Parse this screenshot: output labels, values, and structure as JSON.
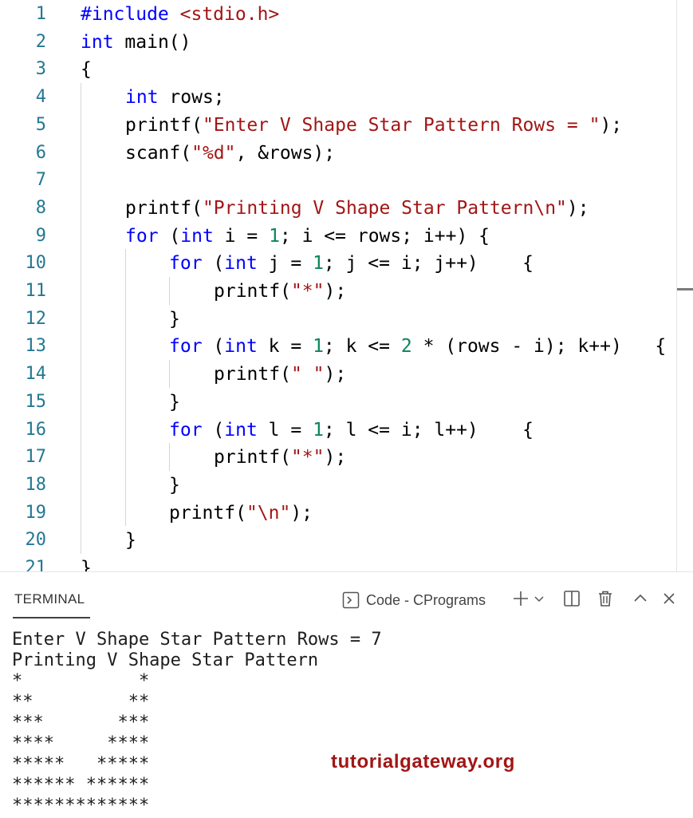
{
  "editor": {
    "line_numbers": [
      "1",
      "2",
      "3",
      "4",
      "5",
      "6",
      "7",
      "8",
      "9",
      "10",
      "11",
      "12",
      "13",
      "14",
      "15",
      "16",
      "17",
      "18",
      "19",
      "20",
      "21"
    ],
    "code": {
      "l1_kw": "#include",
      "l1_str": "<stdio.h>",
      "l2_kw": "int",
      "l2_rest": "main()",
      "l3": "{",
      "l4_kw": "int",
      "l4_rest": "rows;",
      "l5_a": "printf(",
      "l5_str": "\"Enter V Shape Star Pattern Rows = \"",
      "l5_b": ");",
      "l6_a": "scanf(",
      "l6_str": "\"%d\"",
      "l6_b": ", &rows);",
      "l8_a": "printf(",
      "l8_str": "\"Printing V Shape Star Pattern\\n\"",
      "l8_b": ");",
      "l9_kw1": "for",
      "l9_a": "(",
      "l9_kw2": "int",
      "l9_b": "i = ",
      "l9_num": "1",
      "l9_c": "; i <= rows; i++) {",
      "l10_kw1": "for",
      "l10_a": "(",
      "l10_kw2": "int",
      "l10_b": "j = ",
      "l10_num": "1",
      "l10_c": "; j <= i; j++)    {",
      "l11_a": "printf(",
      "l11_str": "\"*\"",
      "l11_b": ");",
      "l12": "}",
      "l13_kw1": "for",
      "l13_a": "(",
      "l13_kw2": "int",
      "l13_b": "k = ",
      "l13_num1": "1",
      "l13_c": "; k <= ",
      "l13_num2": "2",
      "l13_d": " * (rows - i); k++)   {",
      "l14_a": "printf(",
      "l14_str": "\" \"",
      "l14_b": ");",
      "l15": "}",
      "l16_kw1": "for",
      "l16_a": "(",
      "l16_kw2": "int",
      "l16_b": "l = ",
      "l16_num": "1",
      "l16_c": "; l <= i; l++)    {",
      "l17_a": "printf(",
      "l17_str": "\"*\"",
      "l17_b": ");",
      "l18": "}",
      "l19_a": "printf(",
      "l19_str": "\"\\n\"",
      "l19_b": ");",
      "l20": "}",
      "l21": "}"
    }
  },
  "panel": {
    "tab_label": "TERMINAL",
    "terminal_name": "Code - CPrograms",
    "output": [
      "Enter V Shape Star Pattern Rows = 7",
      "Printing V Shape Star Pattern",
      "*           *",
      "**         **",
      "***       ***",
      "****     ****",
      "*****   *****",
      "****** ******",
      "*************"
    ]
  },
  "watermark": "tutorialgateway.org",
  "icons": [
    "terminal-icon",
    "plus-icon",
    "chevron-down-icon",
    "split-icon",
    "trash-icon",
    "chevron-up-icon",
    "close-icon"
  ],
  "colors": {
    "keyword": "#0000ff",
    "string": "#a31515",
    "number": "#098658",
    "line_number": "#237893",
    "watermark": "#a31515"
  }
}
